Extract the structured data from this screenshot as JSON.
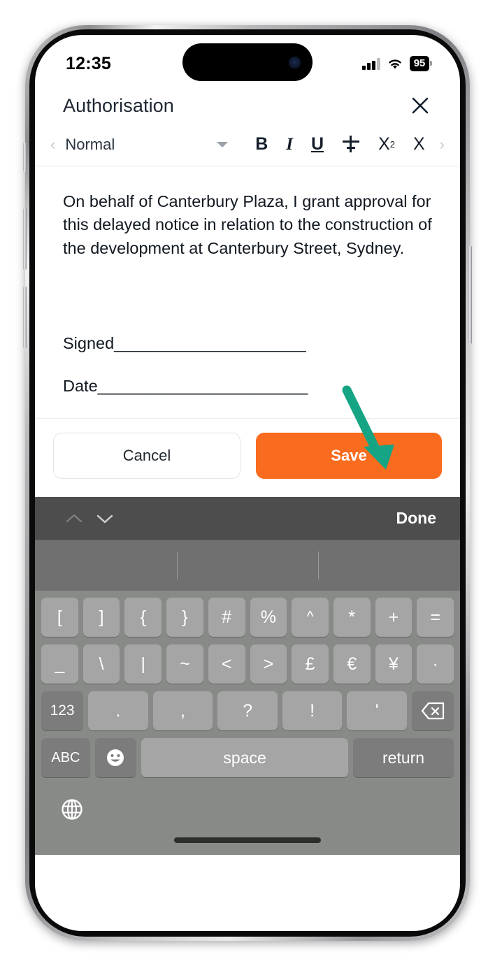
{
  "status_bar": {
    "time": "12:35",
    "battery_level": "95",
    "signal_icon": "cellular-signal-icon",
    "wifi_icon": "wifi-icon",
    "battery_icon": "battery-icon"
  },
  "modal": {
    "title": "Authorisation",
    "close_icon": "close-icon"
  },
  "format_toolbar": {
    "scroll_left_icon": "chevron-left-icon",
    "scroll_right_icon": "chevron-right-icon",
    "style_label": "Normal",
    "dropdown_icon": "caret-down-icon",
    "bold_label": "B",
    "italic_label": "I",
    "underline_label": "U",
    "strikethrough_icon": "strikethrough-icon",
    "superscript_base": "X",
    "superscript_exp": "2",
    "subscript_base": "X",
    "subscript_exp": ""
  },
  "document": {
    "paragraph": "On behalf of Canterbury Plaza, I grant approval for this delayed notice in relation to the construction of the development at Canterbury Street, Sydney.",
    "signed_line": "Signed_____________________",
    "date_line": "Date_______________________"
  },
  "actions": {
    "cancel_label": "Cancel",
    "save_label": "Save",
    "save_color": "#F96B1E"
  },
  "annotation": {
    "type": "arrow",
    "color": "#15a484",
    "points_to": "save-button"
  },
  "keyboard": {
    "accessory": {
      "prev_icon": "chevron-up-icon",
      "next_icon": "chevron-down-icon",
      "done_label": "Done"
    },
    "predictions": [
      "",
      "",
      ""
    ],
    "rows": [
      [
        "[",
        "]",
        "{",
        "}",
        "#",
        "%",
        "^",
        "*",
        "+",
        "="
      ],
      [
        "_",
        "\\",
        "|",
        "~",
        "<",
        ">",
        "£",
        "€",
        "¥",
        "·"
      ],
      [
        "123",
        ".",
        ",",
        "?",
        "!",
        "'",
        "backspace-icon"
      ],
      [
        "ABC",
        "emoji-icon",
        "space",
        "return"
      ]
    ],
    "globe_icon": "globe-icon",
    "home_indicator": "home-indicator"
  }
}
